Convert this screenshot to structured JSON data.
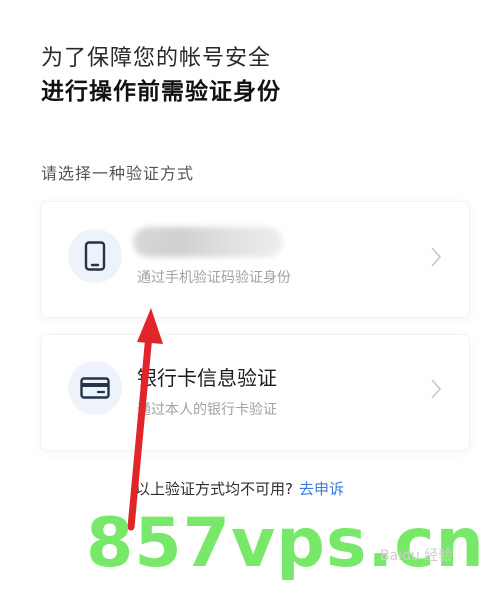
{
  "header": {
    "subtitle": "为了保障您的帐号安全",
    "title": "进行操作前需验证身份"
  },
  "section_label": "请选择一种验证方式",
  "options": [
    {
      "icon": "phone-icon",
      "title": "",
      "description": "通过手机验证码验证身份"
    },
    {
      "icon": "bank-card-icon",
      "title": "银行卡信息验证",
      "description": "通过本人的银行卡验证"
    }
  ],
  "footer": {
    "text": "以上验证方式均不可用?",
    "link": "去申诉"
  },
  "watermark": {
    "text": "857vps.cn",
    "baidu": "Baidu 经验"
  },
  "colors": {
    "accent": "#3a7de0",
    "arrow": "#e0262b",
    "watermark": "#78e86a",
    "icon_bg": "#eef3fb"
  }
}
